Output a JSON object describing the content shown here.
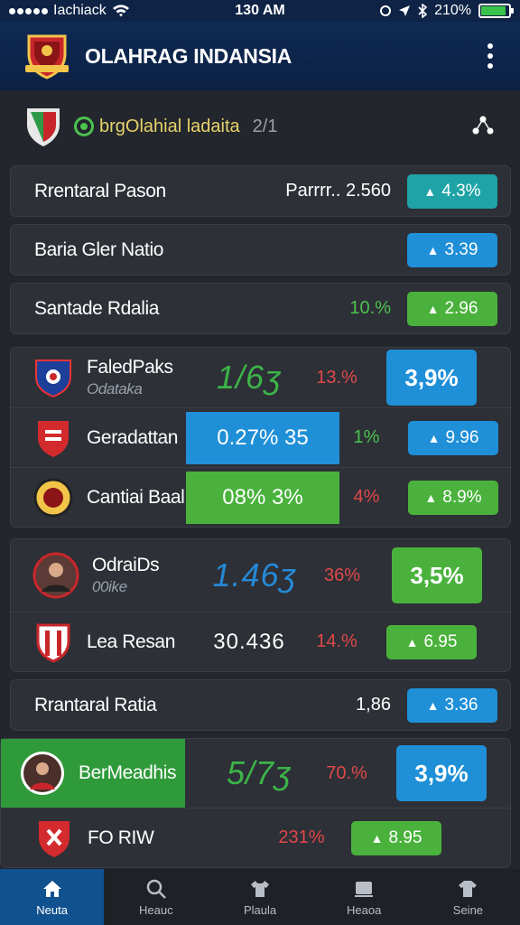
{
  "status": {
    "carrier": "Iachiack",
    "time": "130 AM",
    "battery": "210%"
  },
  "header": {
    "title": "OLAHRAG INDANSIA"
  },
  "subheader": {
    "title": "brgOlahial ladaita",
    "count": "2/1"
  },
  "summary_rows": [
    {
      "label": "Rrentaral Pason",
      "mid": "Parrrr.. 2.560",
      "pill": "4.3%",
      "pill_color": "teal"
    },
    {
      "label": "Baria Gler Natio",
      "mid": "",
      "pill": "3.39",
      "pill_color": "blue"
    },
    {
      "label": "Santade Rdalia",
      "mid": "10.%",
      "pill": "2.96",
      "pill_color": "green"
    }
  ],
  "group1": [
    {
      "name": "FaledPaks",
      "sub": "Odataka",
      "score": "1/6ʒ",
      "pct": "13.%",
      "pill": "3,9%"
    },
    {
      "name": "Geradattan",
      "highlight": "0.27% 35",
      "pct": "1%",
      "pill": "9.96"
    },
    {
      "name": "Cantiai Baal",
      "highlight": "08% 3%",
      "pct": "4%",
      "pill": "8.9%"
    }
  ],
  "group2": [
    {
      "name": "OdraiDs",
      "sub": "00ike",
      "score": "1.46ʒ",
      "pct": "36%",
      "pill": "3,5%"
    },
    {
      "name": "Lea Resan",
      "score": "30.436",
      "pct": "14.%",
      "pill": "6.95"
    }
  ],
  "row_single": {
    "label": "Rrantaral Ratia",
    "mid": "1,86",
    "pill": "3.36"
  },
  "group3": [
    {
      "name": "BerMeadhis",
      "score": "5/7ʒ",
      "pct": "70.%",
      "pill": "3,9%"
    },
    {
      "name": "FO RIW",
      "pct": "231%",
      "pill": "8.95"
    }
  ],
  "tabs": [
    {
      "label": "Neuta"
    },
    {
      "label": "Heauc"
    },
    {
      "label": "Plaula"
    },
    {
      "label": "Heaoa"
    },
    {
      "label": "Seine"
    }
  ],
  "colors": {
    "accent_blue": "#1f8fd8",
    "accent_green": "#4ab23c",
    "accent_teal": "#1fa3a6",
    "negative_red": "#e0484a",
    "header_navy": "#0f2a54"
  }
}
